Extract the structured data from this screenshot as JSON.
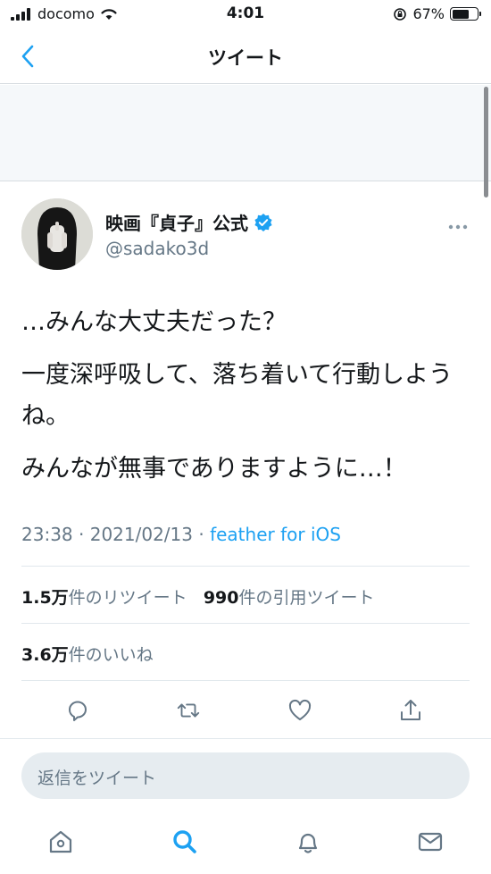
{
  "status_bar": {
    "carrier": "docomo",
    "time": "4:01",
    "battery_percent": "67%",
    "battery_level": 0.67
  },
  "nav": {
    "title": "ツイート"
  },
  "tweet": {
    "display_name": "映画『貞子』公式",
    "handle": "@sadako3d",
    "text_lines": [
      "…みんな大丈夫だった？",
      "一度深呼吸して、落ち着いて行動しようね。",
      "みんなが無事でありますように…！"
    ],
    "time": "23:38",
    "date": "2021/02/13",
    "source": "feather for iOS",
    "retweets_count": "1.5万",
    "retweets_label": "件のリツイート",
    "quotes_count": "990",
    "quotes_label": "件の引用ツイート",
    "likes_count": "3.6万",
    "likes_label": "件のいいね"
  },
  "reply": {
    "placeholder": "返信をツイート"
  },
  "colors": {
    "accent": "#1da1f2",
    "secondary_text": "#657786",
    "divider": "#e1e8ed"
  },
  "icons": {
    "back": "chevron-left-icon",
    "verified": "verified-badge-icon",
    "more": "more-horizontal-icon",
    "reply": "reply-icon",
    "retweet": "retweet-icon",
    "like": "heart-icon",
    "share": "share-icon",
    "home": "home-icon",
    "search": "search-icon",
    "notifications": "bell-icon",
    "messages": "mail-icon"
  }
}
